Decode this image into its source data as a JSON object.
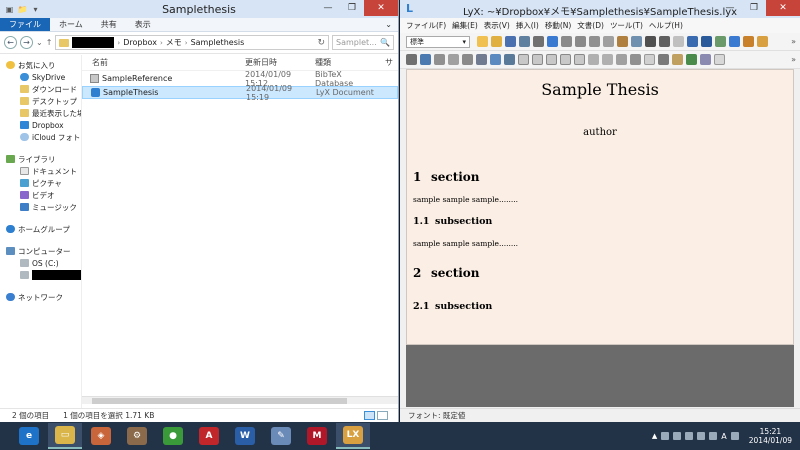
{
  "explorer": {
    "title": "Samplethesis",
    "quick_access": [
      "▣",
      "📁",
      "▾"
    ],
    "window_controls": [
      "—",
      "❐",
      "✕"
    ],
    "ribbon_tabs": [
      "ファイル",
      "ホーム",
      "共有",
      "表示"
    ],
    "ribbon_chevron": "⌄",
    "address": {
      "path": [
        "Dropbox",
        "メモ",
        "Samplethesis"
      ],
      "search_placeholder": "Samplet...",
      "search_icon": "🔍",
      "refresh_icon": "↻"
    },
    "nav_buttons": [
      "←",
      "→",
      "⌄",
      "↑"
    ],
    "nav_pane": {
      "favorites": {
        "label": "お気に入り",
        "items": [
          "SkyDrive",
          "ダウンロード",
          "デスクトップ",
          "最近表示した場",
          "Dropbox",
          "iCloud フォト"
        ]
      },
      "libraries": {
        "label": "ライブラリ",
        "items": [
          "ドキュメント",
          "ピクチャ",
          "ビデオ",
          "ミュージック"
        ]
      },
      "homegroup": "ホームグループ",
      "computer": {
        "label": "コンピューター",
        "items": [
          "OS (C:)"
        ]
      },
      "network": "ネットワーク"
    },
    "columns": {
      "name": "名前",
      "date": "更新日時",
      "type": "種類",
      "more": "サ"
    },
    "files": [
      {
        "name": "SampleReference",
        "date": "2014/01/09 15:12",
        "type": "BibTeX Database",
        "icon": "bibtex-file-icon"
      },
      {
        "name": "SampleThesis",
        "date": "2014/01/09 15:19",
        "type": "LyX Document",
        "icon": "lyx-file-icon",
        "selected": true
      }
    ],
    "status": {
      "count": "2 個の項目",
      "selection": "1 個の項目を選択  1.71 KB"
    }
  },
  "lyx": {
    "title": "LyX: ~¥Dropbox¥メモ¥Samplethesis¥SampleThesis.lyx",
    "logo": "L",
    "menu": [
      "ファイル(F)",
      "編集(E)",
      "表示(V)",
      "挿入(I)",
      "移動(N)",
      "文書(D)",
      "ツール(T)",
      "ヘルプ(H)"
    ],
    "style_select": "標準",
    "toolbar_more": "»",
    "document": {
      "title": "Sample Thesis",
      "author": "author",
      "sections": [
        {
          "num": "1",
          "title": "section"
        },
        {
          "num": "2",
          "title": "section"
        }
      ],
      "subsections": [
        {
          "num": "1.1",
          "title": "subsection"
        },
        {
          "num": "2.1",
          "title": "subsection"
        }
      ],
      "body_texts": [
        "sample sample sample........",
        "sample sample sample........"
      ]
    },
    "status": "フォント: 既定値"
  },
  "taskbar": {
    "apps": [
      {
        "name": "ie",
        "glyph": "e",
        "color": "#1e73c8"
      },
      {
        "name": "explorer",
        "glyph": "▭",
        "color": "#d9b54a"
      },
      {
        "name": "app3",
        "glyph": "◈",
        "color": "#c8653a"
      },
      {
        "name": "app4",
        "glyph": "⚙",
        "color": "#8a6a4a"
      },
      {
        "name": "chrome",
        "glyph": "●",
        "color": "#3a9a3a"
      },
      {
        "name": "acrobat",
        "glyph": "A",
        "color": "#c0262a"
      },
      {
        "name": "word",
        "glyph": "W",
        "color": "#2a5fa8"
      },
      {
        "name": "paint",
        "glyph": "✎",
        "color": "#6a8ab8"
      },
      {
        "name": "mendeley",
        "glyph": "M",
        "color": "#b0182a"
      },
      {
        "name": "lyx",
        "glyph": "LX",
        "color": "#d8a040"
      }
    ],
    "tray_chevron": "▲",
    "ime": "A",
    "time": "15:21",
    "date": "2014/01/09"
  }
}
